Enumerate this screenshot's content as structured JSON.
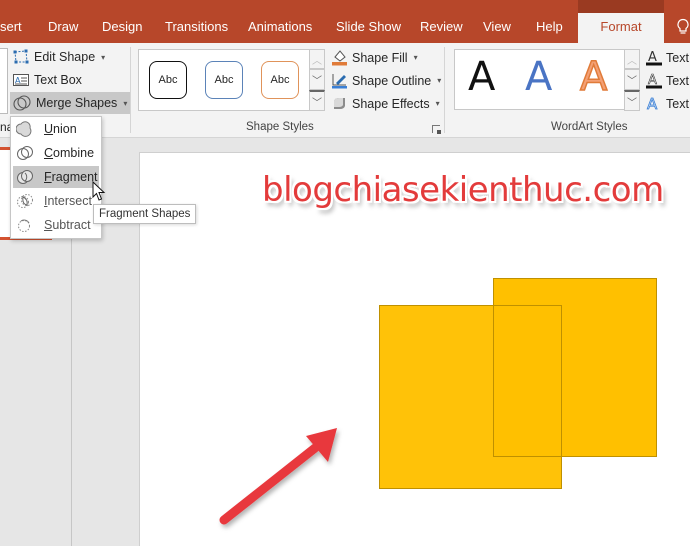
{
  "tabs": [
    {
      "label": "sert"
    },
    {
      "label": "Draw"
    },
    {
      "label": "Design"
    },
    {
      "label": "Transitions"
    },
    {
      "label": "Animations"
    },
    {
      "label": "Slide Show"
    },
    {
      "label": "Review"
    },
    {
      "label": "View"
    },
    {
      "label": "Help"
    },
    {
      "label": "Format",
      "active": true
    }
  ],
  "colors": {
    "brand": "#b7472a",
    "shape_fill": "#ffc000",
    "shape_outline": "#bf9000",
    "arrow": "#e8383d",
    "watermark": "#e33b3b"
  },
  "insert_shapes": {
    "edit_shape": "Edit Shape",
    "text_box": "Text Box",
    "merge_shapes": "Merge Shapes",
    "partial_label": "na"
  },
  "shape_styles": {
    "thumbs": [
      "Abc",
      "Abc",
      "Abc"
    ],
    "shape_fill": "Shape Fill",
    "shape_outline": "Shape Outline",
    "shape_effects": "Shape Effects",
    "group_label": "Shape Styles"
  },
  "wordart_styles": {
    "letters": [
      "A",
      "A",
      "A"
    ],
    "text_fill": "Text",
    "text_outline": "Text",
    "text_effects": "Text",
    "group_label": "WordArt Styles"
  },
  "merge_menu": {
    "items": [
      {
        "label": "Union",
        "accel": "U",
        "rest": "nion"
      },
      {
        "label": "Combine",
        "accel": "C",
        "rest": "ombine"
      },
      {
        "label": "Fragment",
        "accel": "F",
        "rest": "ragment",
        "hover": true
      },
      {
        "label": "Intersect",
        "accel": "I",
        "rest": "ntersect"
      },
      {
        "label": "Subtract",
        "accel": "S",
        "rest": "ubtract"
      }
    ],
    "tooltip": "Fragment Shapes"
  },
  "slide": {
    "watermark": "blogchiasekienthuc.com",
    "shapes": [
      {
        "name": "rectangle-1"
      },
      {
        "name": "rectangle-2"
      }
    ]
  }
}
